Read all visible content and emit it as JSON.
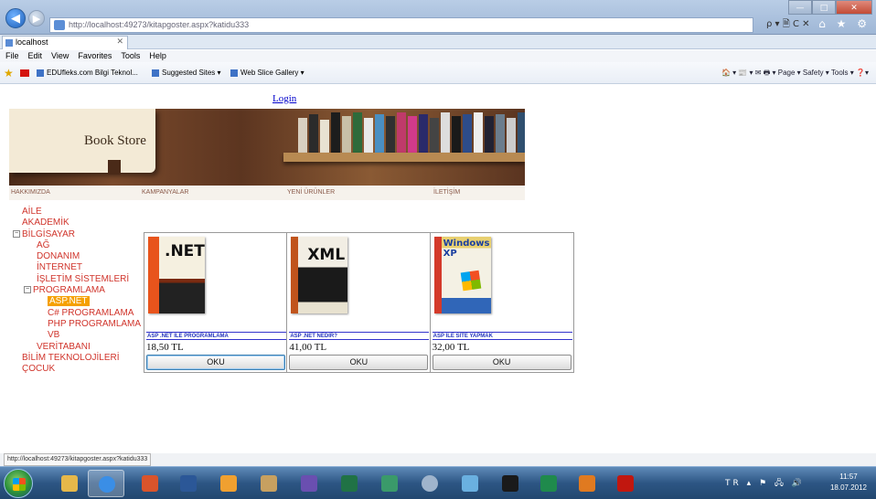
{
  "browser": {
    "address": "http://localhost:49273/kitapgoster.aspx?katidu333",
    "address_host": "localhost",
    "tab_title": "localhost",
    "search_controls": "ρ ▾ 🗎 C ✕",
    "window_icons": "⌂ ★ ⚙",
    "menu": [
      "File",
      "Edit",
      "View",
      "Favorites",
      "Tools",
      "Help"
    ],
    "favorites": [
      "EDUfleks.com Bilgi Teknol...",
      "Suggested Sites ▾",
      "Web Slice Gallery ▾"
    ],
    "command_bar": "🏠 ▾  📰 ▾  ✉  🖶 ▾  Page ▾  Safety ▾  Tools ▾  ❓▾",
    "status_url": "http://localhost:49273/kitapgoster.aspx?katidu333"
  },
  "page": {
    "login_link": "Login",
    "banner_title": "Book Store",
    "top_nav": [
      "HAKKIMIZDA",
      "KAMPANYALAR",
      "YENİ ÜRÜNLER",
      "İLETİŞİM"
    ],
    "menu": {
      "aile": "AİLE",
      "akademik": "AKADEMİK",
      "bilgisayar": "BİLGİSAYAR",
      "ag": "AĞ",
      "donanim": "DONANIM",
      "internet": "İNTERNET",
      "isletim": "İŞLETİM SİSTEMLERİ",
      "programlama": "PROGRAMLAMA",
      "aspnet": "ASP.NET",
      "csharp": "C# PROGRAMLAMA",
      "php": "PHP PROGRAMLAMA",
      "vb": "VB",
      "veritabani": "VERİTABANI",
      "bilim": "BİLİM TEKNOLOJİLERİ",
      "cocuk": "ÇOCUK",
      "expand_minus": "−"
    },
    "products": [
      {
        "cover_text": ".NET",
        "name": "ASP .NET İLE PROGRAMLAMA",
        "price": "18,50 TL",
        "button": "OKU"
      },
      {
        "cover_text": "XML",
        "name": "ASP .NET NEDİR?",
        "price": "41,00 TL",
        "button": "OKU"
      },
      {
        "cover_text": "Windows XP",
        "name": "ASP İLE SİTE YAPMAK",
        "price": "32,00 TL",
        "button": "OKU"
      }
    ]
  },
  "taskbar": {
    "tray": "TR ▴ ⚑ 🖧 🔊",
    "time": "11:57",
    "date": "18.07.2012"
  }
}
